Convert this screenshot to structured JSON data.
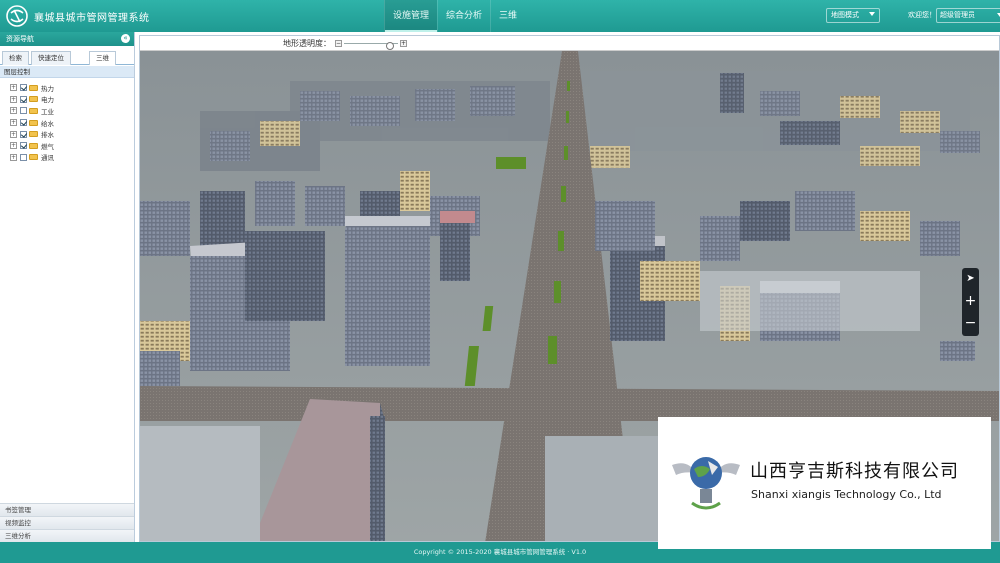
{
  "app": {
    "title": "襄城县城市管网管理系统"
  },
  "nav": {
    "tabs": [
      "设施管理",
      "综合分析",
      "三维"
    ],
    "active_index": 0
  },
  "header": {
    "map_type": "地图模式",
    "welcome_label": "欢迎您！",
    "user": "超级管理员"
  },
  "sidebar": {
    "title": "资源导航",
    "tabs": [
      "检索",
      "快速定位",
      "三维"
    ],
    "active_tab_index": 2,
    "section_title": "图层控制",
    "layers": [
      {
        "label": "热力",
        "checked": true
      },
      {
        "label": "电力",
        "checked": true
      },
      {
        "label": "工业",
        "checked": false
      },
      {
        "label": "给水",
        "checked": true
      },
      {
        "label": "排水",
        "checked": true
      },
      {
        "label": "燃气",
        "checked": true
      },
      {
        "label": "通讯",
        "checked": false
      }
    ],
    "bottom_menu": [
      "书签管理",
      "视频监控",
      "三维分析"
    ]
  },
  "map": {
    "opacity_label": "地形透明度：",
    "opacity_value": 0.85,
    "zoom_in": "+",
    "zoom_out": "−"
  },
  "watermark": {
    "company_cn": "山西亨吉斯科技有限公司",
    "company_en": "Shanxi xiangis Technology Co., Ltd"
  },
  "footer": {
    "copyright": "Copyright © 2015-2020 襄城县城市管网管理系统 · V1.0"
  },
  "colors": {
    "header": "#1f9a92",
    "accent": "#2aa79d"
  }
}
